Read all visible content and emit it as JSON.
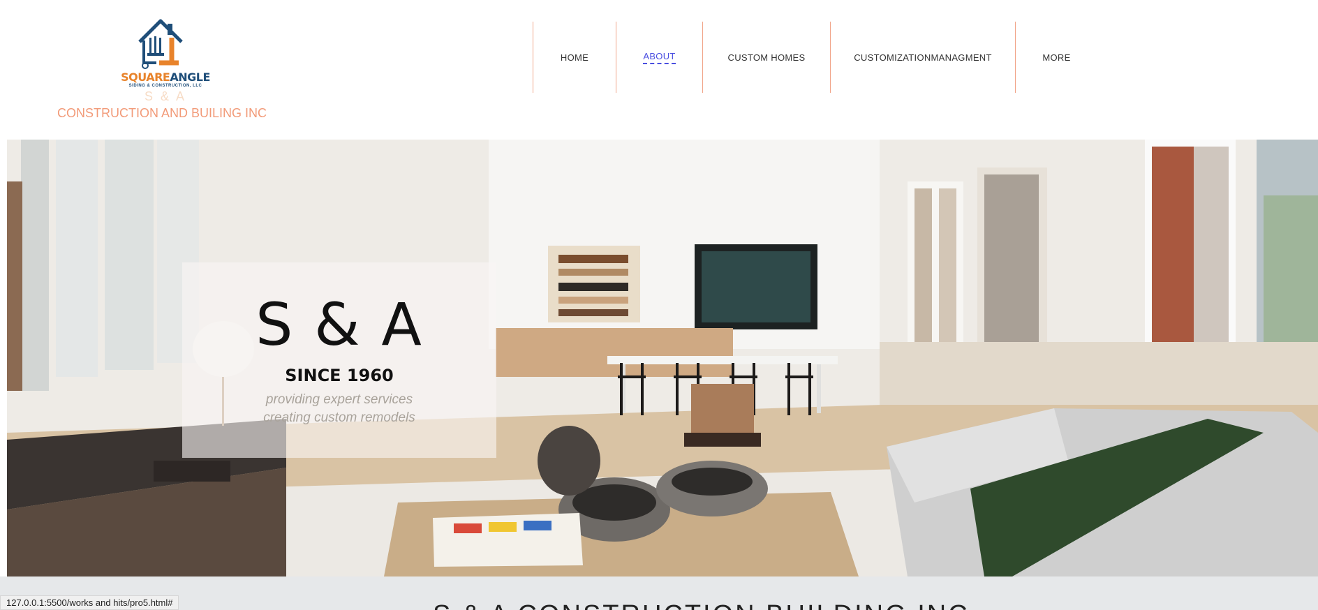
{
  "brand": {
    "logo_word_1": "SQUARE",
    "logo_word_2": "ANGLE",
    "logo_subtitle": "SIDING & CONSTRUCTION, LLC",
    "short_name": "S & A",
    "full_name": "CONSTRUCTION AND BUILING INC",
    "colors": {
      "orange": "#e8832b",
      "navy": "#1f4e79",
      "salmon": "#f29a78"
    }
  },
  "nav": {
    "items": [
      {
        "label": "HOME"
      },
      {
        "label": "ABOUT",
        "active": true
      },
      {
        "label": "CUSTOM HOMES"
      },
      {
        "label": "CUSTOMIZATIONMANAGMENT"
      },
      {
        "label": "MORE"
      }
    ],
    "active_color": "#4a4ee0",
    "divider_color": "#f1a488"
  },
  "hero": {
    "title": "S & A",
    "since": "SINCE 1960",
    "line1": "providing expert services",
    "line2": "creating custom remodels"
  },
  "section": {
    "title": "S & A CONSTRUCTION BUILDING INC"
  },
  "status_bar": {
    "url": "127.0.0.1:5500/works and hits/pro5.html#"
  }
}
